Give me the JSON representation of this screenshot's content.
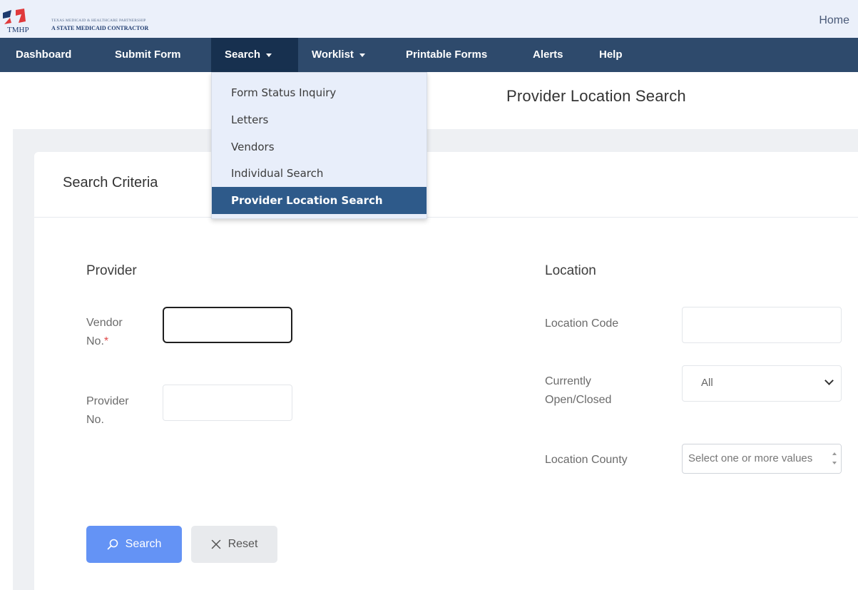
{
  "header": {
    "logo_top": "Texas Medicaid & Healthcare Partnership",
    "logo_bottom": "A STATE MEDICAID CONTRACTOR",
    "logo_abbr": "TMHP",
    "home": "Home"
  },
  "nav": {
    "items": [
      {
        "label": "Dashboard"
      },
      {
        "label": "Submit Form"
      },
      {
        "label": "Search"
      },
      {
        "label": "Worklist"
      },
      {
        "label": "Printable Forms"
      },
      {
        "label": "Alerts"
      },
      {
        "label": "Help"
      }
    ]
  },
  "dropdown": {
    "items": [
      {
        "label": "Form Status Inquiry"
      },
      {
        "label": "Letters"
      },
      {
        "label": "Vendors"
      },
      {
        "label": "Individual Search"
      },
      {
        "label": "Provider Location Search",
        "active": true
      }
    ]
  },
  "page": {
    "title": "Provider Location Search"
  },
  "card": {
    "title": "Search Criteria"
  },
  "provider": {
    "section_title": "Provider",
    "vendor_label_1": "Vendor",
    "vendor_label_2": "No.",
    "vendor_required": "*",
    "vendor_value": "",
    "provider_label_1": "Provider",
    "provider_label_2": "No.",
    "provider_value": ""
  },
  "location": {
    "section_title": "Location",
    "code_label": "Location Code",
    "code_value": "",
    "status_label_1": "Currently",
    "status_label_2": "Open/Closed",
    "status_selected": "All",
    "county_label": "Location County",
    "county_placeholder": "Select one or more values"
  },
  "buttons": {
    "search": "Search",
    "reset": "Reset"
  },
  "colors": {
    "nav_bg": "#2e4a6c",
    "nav_active": "#17304f",
    "dropdown_active": "#2e5a8a",
    "primary": "#6493f5",
    "brand_red": "#e0393b",
    "brand_blue": "#1d3a6e"
  }
}
